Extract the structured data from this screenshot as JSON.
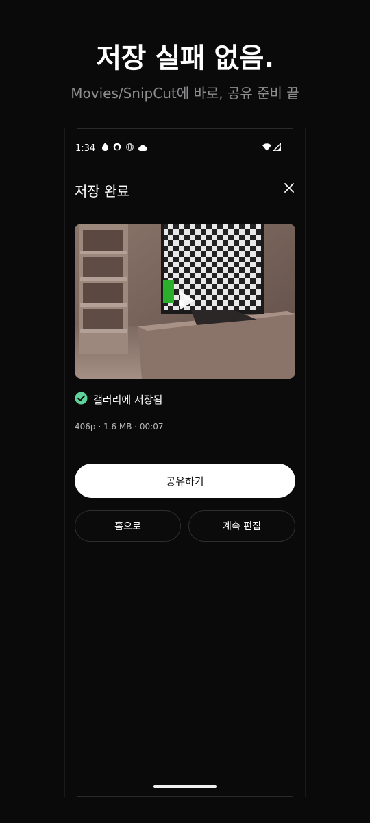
{
  "hero": {
    "title": "저장 실패 없음.",
    "subtitle": "Movies/SnipCut에 바로, 공유 준비 끝"
  },
  "status_bar": {
    "time": "1:34",
    "left_icons": [
      "drop-icon",
      "face-icon",
      "globe-icon",
      "cloud-icon"
    ],
    "right_icons": [
      "wifi-icon",
      "signal-icon"
    ]
  },
  "dialog": {
    "title": "저장 완료",
    "close_icon": "close-icon",
    "saved_label": "갤러리에 저장됨",
    "meta": "406p · 1.6 MB · 00:07"
  },
  "actions": {
    "share_label": "공유하기",
    "home_label": "홈으로",
    "continue_label": "계속 편집"
  },
  "colors": {
    "background": "#0a0a0b",
    "check_green": "#5fd49a",
    "primary_button": "#ffffff"
  }
}
